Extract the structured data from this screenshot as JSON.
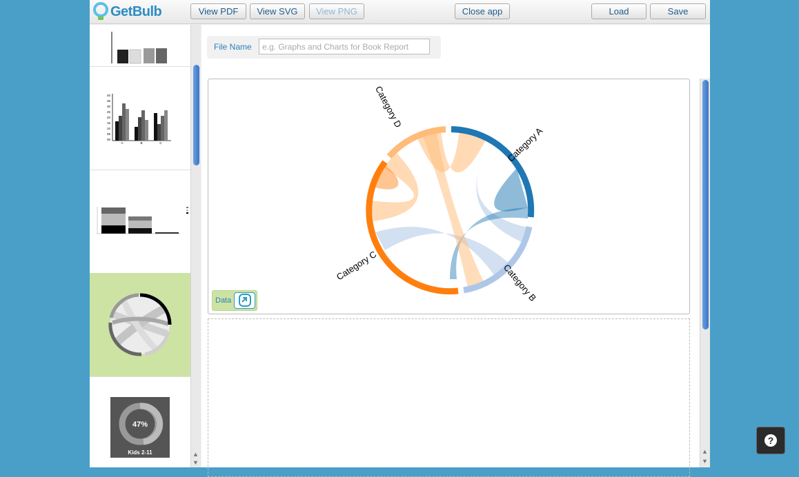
{
  "app": {
    "logo_text": "GetBulb"
  },
  "toolbar": {
    "view_pdf": "View PDF",
    "view_svg": "View SVG",
    "view_png": "View PNG",
    "close_app": "Close app",
    "load": "Load",
    "save": "Save"
  },
  "file": {
    "label": "File Name",
    "value": "",
    "placeholder": "e.g. Graphs and Charts for Book Report"
  },
  "chart_data": {
    "type": "chord",
    "categories": [
      "Category A",
      "Category B",
      "Category C",
      "Category D"
    ],
    "colors": [
      "#1f77b4",
      "#aec7e8",
      "#ff7f0e",
      "#ffbb78"
    ]
  },
  "data_button": {
    "label": "Data"
  },
  "sidebar": {
    "donut_thumb": {
      "percent": "47%",
      "caption": "Kids 2-11"
    },
    "bar_thumb_ticks": [
      "40",
      "35",
      "30",
      "25",
      "20",
      "15",
      "10",
      "05",
      "00"
    ],
    "bar_thumb_cats": [
      "A",
      "B",
      "C"
    ]
  },
  "help": {
    "label": "?"
  }
}
